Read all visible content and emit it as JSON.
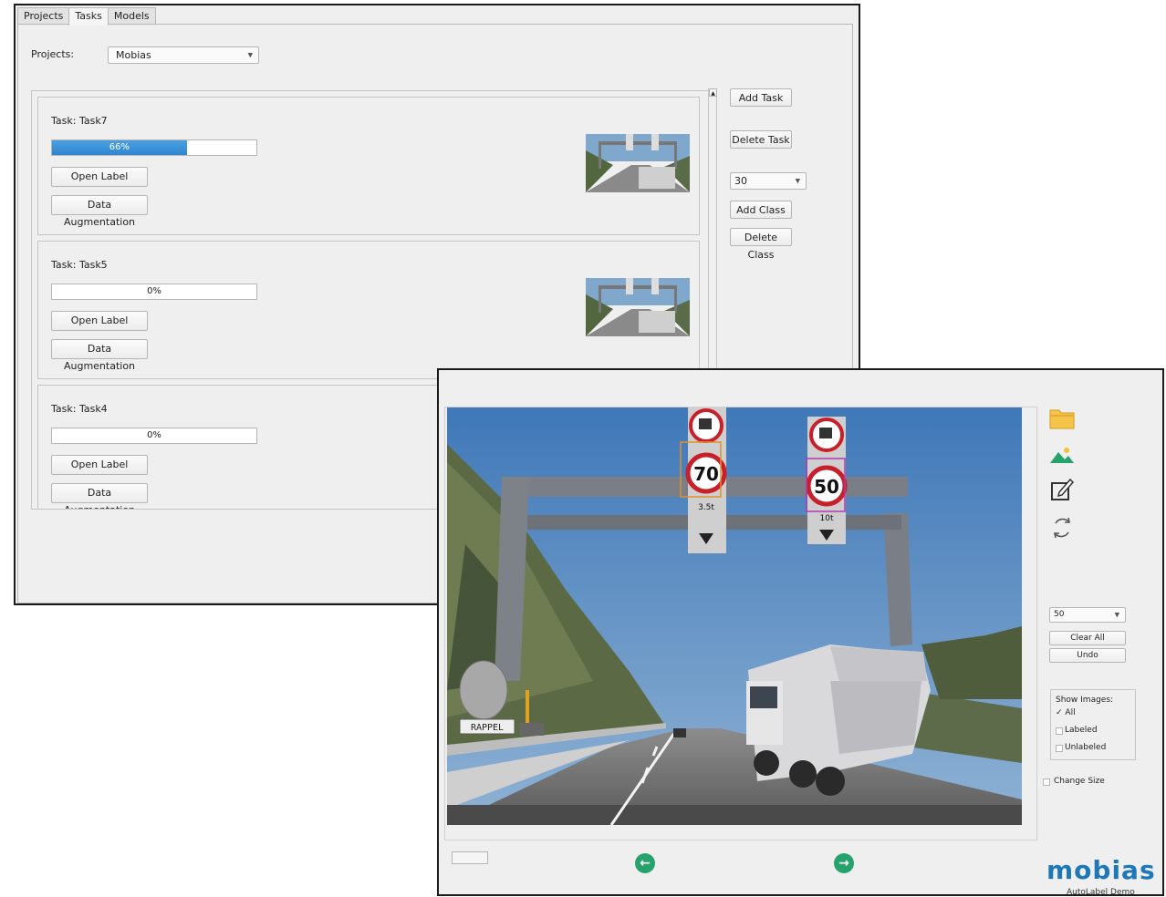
{
  "window_tasks": {
    "tabs": [
      {
        "label": "Projects"
      },
      {
        "label": "Tasks"
      },
      {
        "label": "Models"
      }
    ],
    "projects_label": "Projects:",
    "project_select": "Mobias",
    "tasks": [
      {
        "title": "Task: Task7",
        "progress": 0.66,
        "progress_text": "66%",
        "open_label": "Open Label",
        "augment_label": "Data Augmentation"
      },
      {
        "title": "Task: Task5",
        "progress": 0.0,
        "progress_text": "0%",
        "open_label": "Open Label",
        "augment_label": "Data Augmentation"
      },
      {
        "title": "Task: Task4",
        "progress": 0.0,
        "progress_text": "0%",
        "open_label": "Open Label",
        "augment_label": "Data Augmentation"
      }
    ],
    "side": {
      "add_task": "Add Task",
      "delete_task": "Delete Task",
      "class_select": "30",
      "add_class": "Add Class",
      "delete_class": "Delete Class"
    }
  },
  "window_label": {
    "tools": [
      "folder-icon",
      "image-icon",
      "edit-icon",
      "refresh-icon"
    ],
    "class_select": "50",
    "clear_all": "Clear All",
    "undo": "Undo",
    "show_images": {
      "title": "Show Images:",
      "options": [
        {
          "label": "All",
          "checked": true
        },
        {
          "label": "Labeled",
          "checked": false
        },
        {
          "label": "Unlabeled",
          "checked": false
        }
      ]
    },
    "change_size": "Change Size",
    "scene": {
      "sign_left": "70",
      "sign_right": "50",
      "plate_left": "3.5t",
      "plate_right": "10t",
      "rappel": "RAPPEL"
    },
    "logo": "mobias",
    "logo_sub": "AutoLabel Demo",
    "accent": "#28a26c",
    "brand": "#1e77b8"
  }
}
